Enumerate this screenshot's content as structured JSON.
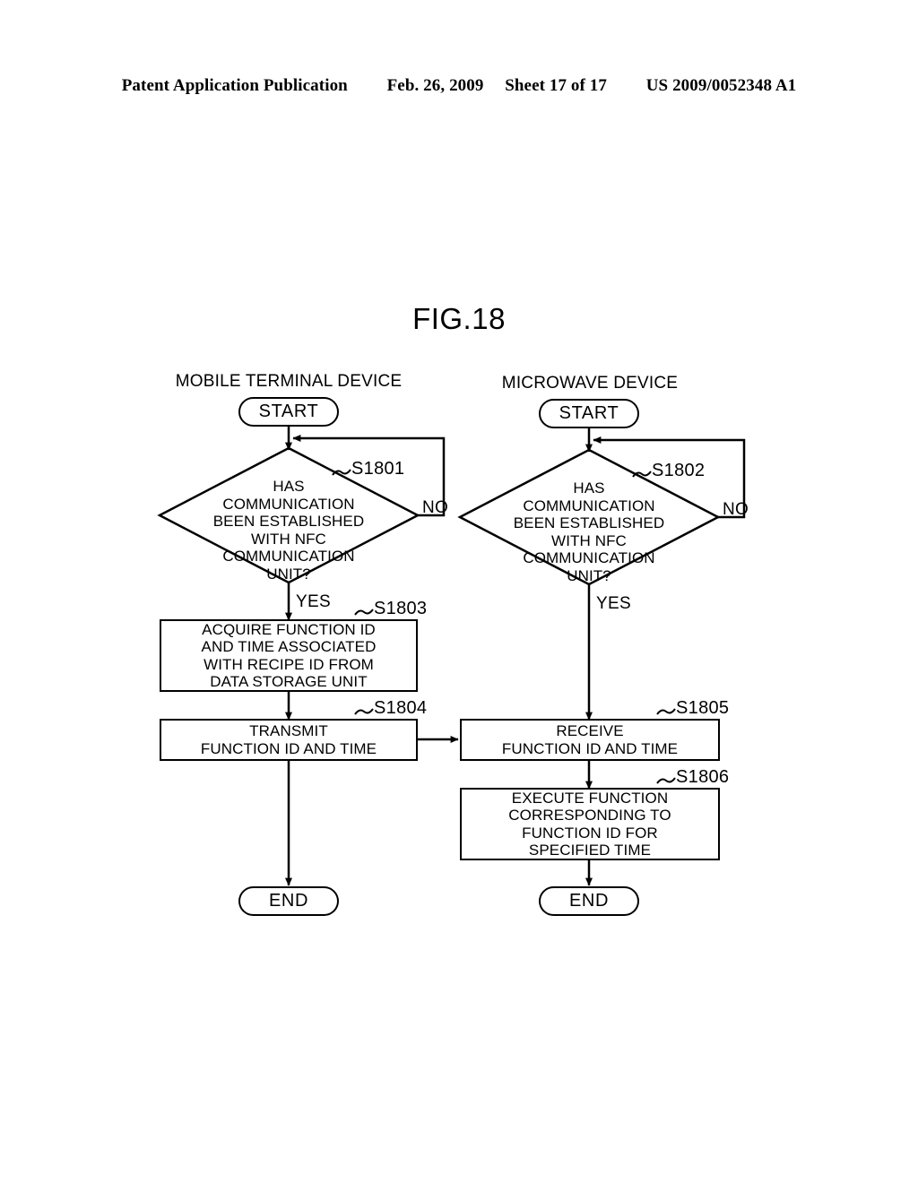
{
  "header": {
    "publication": "Patent Application Publication",
    "date": "Feb. 26, 2009",
    "sheet": "Sheet 17 of 17",
    "patent_number": "US 2009/0052348 A1"
  },
  "figure": {
    "title": "FIG.18"
  },
  "columns": [
    {
      "label": "MOBILE TERMINAL DEVICE"
    },
    {
      "label": "MICROWAVE DEVICE"
    }
  ],
  "terminals": {
    "start_left": "START",
    "start_right": "START",
    "end_left": "END",
    "end_right": "END"
  },
  "decisions": [
    {
      "ref": "S1801",
      "text": "HAS\nCOMMUNICATION\nBEEN ESTABLISHED\nWITH NFC\nCOMMUNICATION\nUNIT?",
      "yes_label": "YES",
      "no_label": "NO"
    },
    {
      "ref": "S1802",
      "text": "HAS\nCOMMUNICATION\nBEEN ESTABLISHED\nWITH NFC\nCOMMUNICATION\nUNIT?",
      "yes_label": "YES",
      "no_label": "NO"
    }
  ],
  "processes": [
    {
      "ref": "S1803",
      "text": "ACQUIRE FUNCTION ID\nAND TIME ASSOCIATED\nWITH RECIPE ID FROM\nDATA STORAGE UNIT"
    },
    {
      "ref": "S1804",
      "text": "TRANSMIT\nFUNCTION ID AND TIME"
    },
    {
      "ref": "S1805",
      "text": "RECEIVE\nFUNCTION ID AND TIME"
    },
    {
      "ref": "S1806",
      "text": "EXECUTE FUNCTION\nCORRESPONDING TO\nFUNCTION ID FOR\nSPECIFIED TIME"
    }
  ],
  "colors": {
    "ink": "#000000",
    "paper": "#ffffff"
  }
}
